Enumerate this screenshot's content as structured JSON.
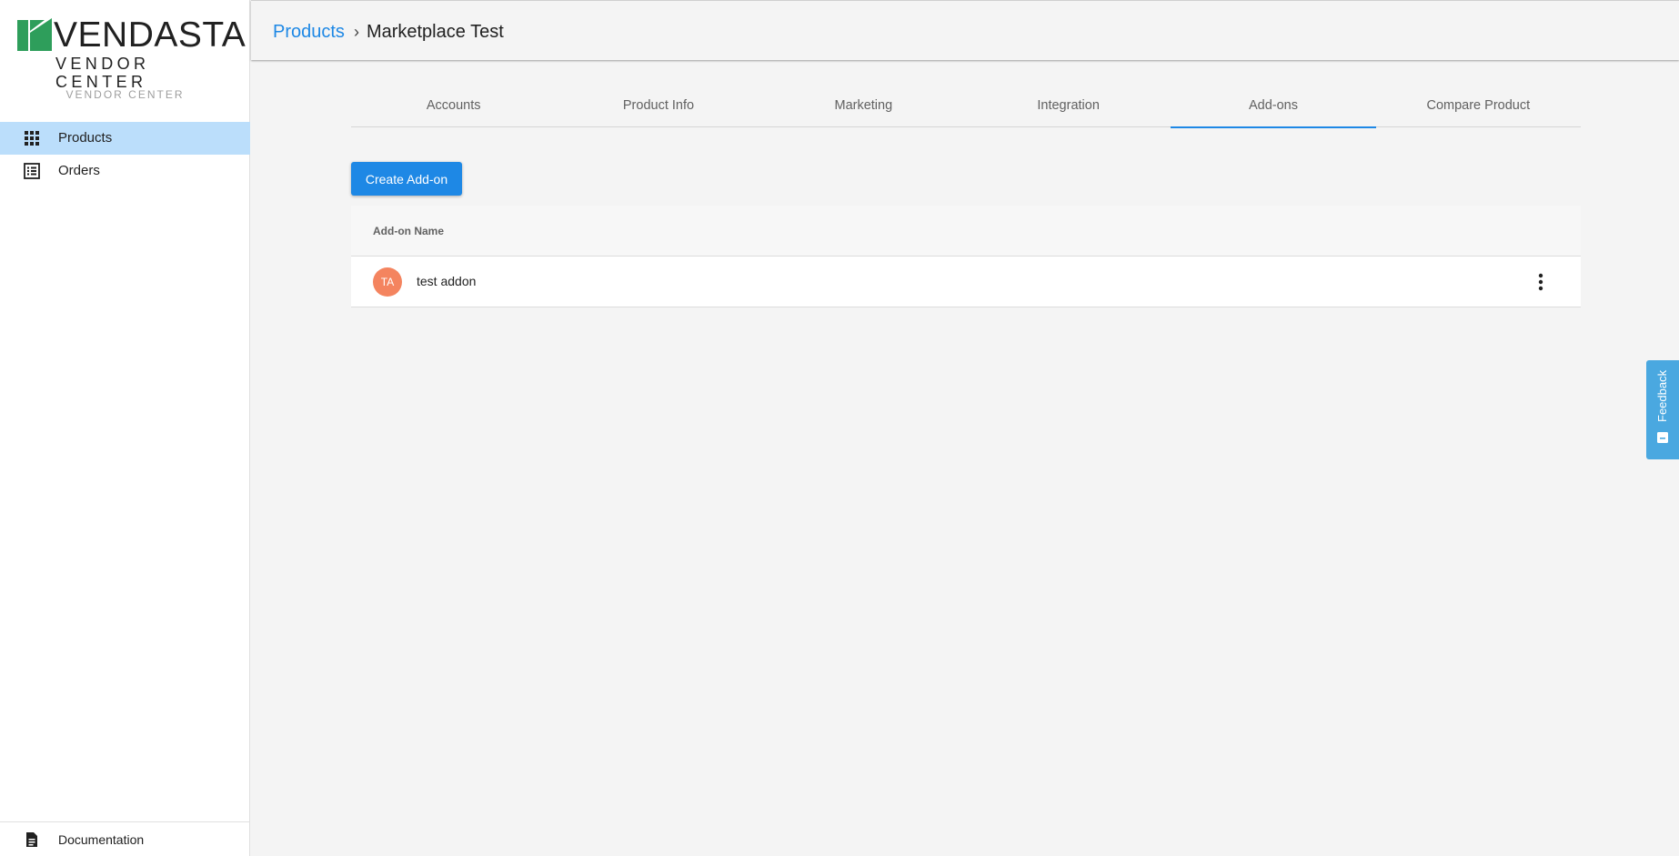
{
  "sidebar": {
    "logo_word": "VENDASTA",
    "logo_sub": "VENDOR CENTER",
    "caption": "VENDOR CENTER",
    "items": [
      {
        "label": "Products",
        "icon": "apps-grid-icon",
        "active": true
      },
      {
        "label": "Orders",
        "icon": "list-icon",
        "active": false
      }
    ],
    "documentation": {
      "label": "Documentation",
      "icon": "document-icon"
    }
  },
  "header": {
    "breadcrumb_root": "Products",
    "separator": "›",
    "breadcrumb_current": "Marketplace Test"
  },
  "tabs": [
    {
      "label": "Accounts",
      "active": false
    },
    {
      "label": "Product Info",
      "active": false
    },
    {
      "label": "Marketing",
      "active": false
    },
    {
      "label": "Integration",
      "active": false
    },
    {
      "label": "Add-ons",
      "active": true
    },
    {
      "label": "Compare Product",
      "active": false
    }
  ],
  "actions": {
    "create_label": "Create Add-on"
  },
  "table": {
    "columns": [
      "Add-on Name"
    ],
    "rows": [
      {
        "initials": "TA",
        "name": "test addon",
        "menu_icon": "more-vert-icon"
      }
    ]
  },
  "feedback": {
    "label": "Feedback",
    "icon": "feedback-icon"
  },
  "colors": {
    "accent": "#1e88e5",
    "active_nav_bg": "#bbdefb",
    "avatar": "#f4845f",
    "feedback_tab": "#4aa8e0",
    "logo_green": "#2e9e5b"
  }
}
